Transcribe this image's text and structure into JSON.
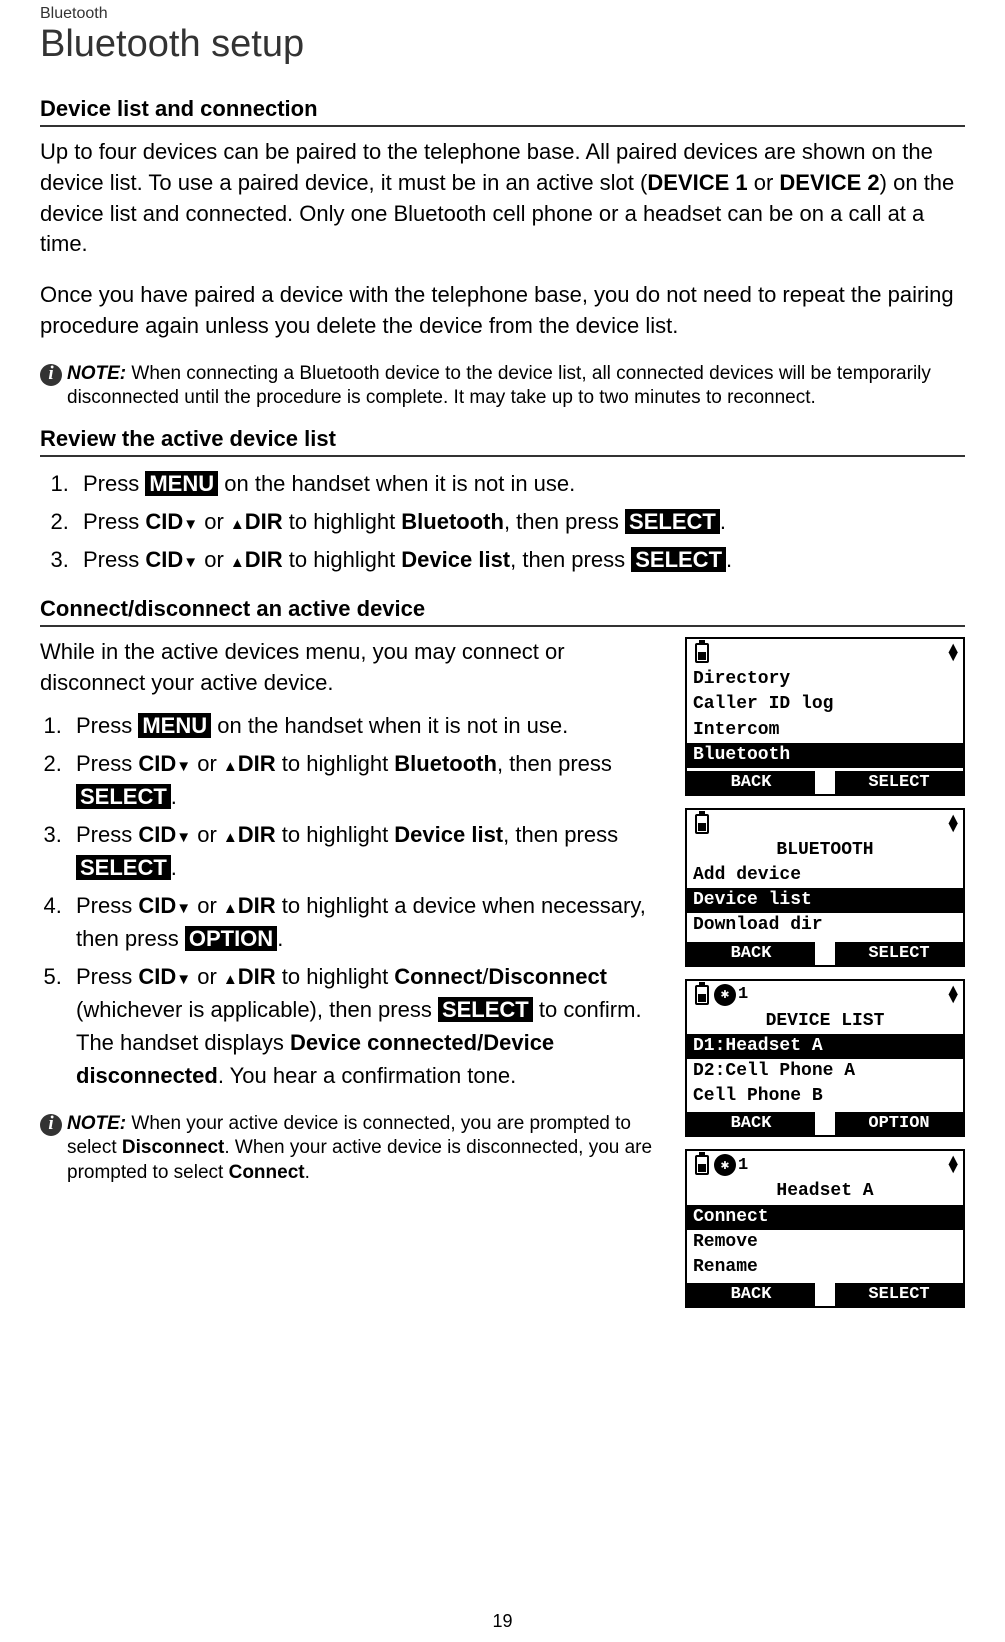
{
  "header": {
    "category": "Bluetooth",
    "title": "Bluetooth setup"
  },
  "section1": {
    "title": "Device list and connection",
    "para1_pre": "Up to four devices can be paired to the telephone base. All paired devices are shown on the device list. To use a paired device, it must be in an active slot (",
    "para1_b1": "DEVICE 1",
    "para1_mid": " or ",
    "para1_b2": "DEVICE 2",
    "para1_post": ") on the device list and connected. Only one Bluetooth cell phone or a headset can be on a call at a time.",
    "para2": "Once you have paired a device with the telephone base, you do not need to repeat the pairing procedure again unless you delete the device from the device list.",
    "note_label": "NOTE:",
    "note_text": " When connecting a Bluetooth device to the device list, all connected devices will be temporarily disconnected until the procedure is complete. It may take up to two minutes to reconnect."
  },
  "section2": {
    "title": "Review the active device list",
    "steps": {
      "s1_pre": "Press ",
      "s1_menu": "MENU",
      "s1_post": " on the handset when it is not in use.",
      "s2_pre": "Press ",
      "s2_cid": "CID",
      "s2_or": " or ",
      "s2_dir": "DIR",
      "s2_mid": " to highlight ",
      "s2_bt": "Bluetooth",
      "s2_then": ", then press ",
      "s2_select": "SELECT",
      "s2_end": ".",
      "s3_pre": "Press ",
      "s3_cid": "CID",
      "s3_or": " or ",
      "s3_dir": "DIR",
      "s3_mid": " to highlight ",
      "s3_dl": "Device list",
      "s3_then": ", then press ",
      "s3_select": "SELECT",
      "s3_end": "."
    }
  },
  "section3": {
    "title": "Connect/disconnect an active device",
    "intro": "While in the active devices menu, you may connect or disconnect your active device.",
    "steps": {
      "s1_pre": "Press ",
      "s1_menu": "MENU",
      "s1_post": " on the handset when it is not in use.",
      "s2_pre": "Press ",
      "s2_cid": "CID",
      "s2_or": " or ",
      "s2_dir": "DIR",
      "s2_mid": " to highlight ",
      "s2_bt": "Bluetooth",
      "s2_then": ", then press ",
      "s2_select": "SELECT",
      "s2_end": ".",
      "s3_pre": "Press ",
      "s3_cid": "CID",
      "s3_or": " or ",
      "s3_dir": "DIR",
      "s3_mid": " to highlight ",
      "s3_dl": "Device list",
      "s3_then": ", then press ",
      "s3_select": "SELECT",
      "s3_end": ".",
      "s4_pre": "Press ",
      "s4_cid": "CID",
      "s4_or": " or ",
      "s4_dir": "DIR",
      "s4_mid": " to highlight a device when necessary, then press ",
      "s4_option": "OPTION",
      "s4_end": ".",
      "s5_pre": "Press ",
      "s5_cid": "CID",
      "s5_or": " or ",
      "s5_dir": "DIR",
      "s5_mid": " to highlight ",
      "s5_connect": "Connect",
      "s5_slash": "/",
      "s5_disconnect": "Disconnect",
      "s5_paren": " (whichever is applicable), then press ",
      "s5_select": "SELECT",
      "s5_confirm": " to confirm. The handset displays ",
      "s5_msg": "Device connected/Device disconnected",
      "s5_end": ". You hear a confirmation tone."
    },
    "note_label": "NOTE:",
    "note_text_pre": " When your active device is connected, you are prompted to select ",
    "note_text_b1": "Disconnect",
    "note_text_mid": ". When your active device is disconnected, you are prompted to select ",
    "note_text_b2": "Connect",
    "note_text_end": "."
  },
  "screens": {
    "screen1": {
      "line1": "Directory",
      "line2": "Caller ID log",
      "line3": "Intercom",
      "line4": "Bluetooth",
      "back": "BACK",
      "select": "SELECT"
    },
    "screen2": {
      "title": "BLUETOOTH",
      "line1": "Add device",
      "line2": "Device list",
      "line3": "Download dir",
      "back": "BACK",
      "select": "SELECT"
    },
    "screen3": {
      "num": "1",
      "title": "DEVICE LIST",
      "line1": "D1:Headset A",
      "line2": "D2:Cell Phone A",
      "line3": "Cell Phone B",
      "back": "BACK",
      "option": "OPTION"
    },
    "screen4": {
      "num": "1",
      "title": "Headset A",
      "line1": "Connect",
      "line2": "Remove",
      "line3": "Rename",
      "back": "BACK",
      "select": "SELECT"
    }
  },
  "page_number": "19"
}
